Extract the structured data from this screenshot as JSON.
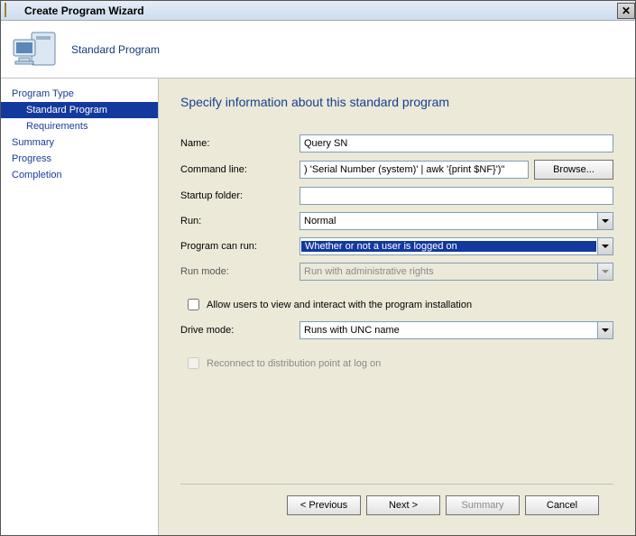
{
  "titlebar": {
    "title": "Create Program Wizard"
  },
  "banner": {
    "subtitle": "Standard Program"
  },
  "sidebar": {
    "items": [
      {
        "label": "Program Type",
        "indent": false,
        "active": false
      },
      {
        "label": "Standard Program",
        "indent": true,
        "active": true
      },
      {
        "label": "Requirements",
        "indent": true,
        "active": false
      },
      {
        "label": "Summary",
        "indent": false,
        "active": false
      },
      {
        "label": "Progress",
        "indent": false,
        "active": false
      },
      {
        "label": "Completion",
        "indent": false,
        "active": false
      }
    ]
  },
  "content": {
    "heading": "Specify information about this standard program",
    "rows": {
      "name": {
        "label": "Name:",
        "value": "Query SN"
      },
      "commandline": {
        "label": "Command line:",
        "value": ") 'Serial Number (system)' | awk '{print $NF}')\""
      },
      "browse": {
        "label": "Browse..."
      },
      "startupfolder": {
        "label": "Startup folder:",
        "value": ""
      },
      "run": {
        "label": "Run:",
        "value": "Normal"
      },
      "programcanrun": {
        "label": "Program can run:",
        "value": "Whether or not a user is logged on"
      },
      "runmode": {
        "label": "Run mode:",
        "value": "Run with administrative rights"
      },
      "drivemode": {
        "label": "Drive mode:",
        "value": "Runs with UNC name"
      }
    },
    "checks": {
      "allowInteract": {
        "label": "Allow users to view and interact with the program installation",
        "checked": false,
        "enabled": true
      },
      "reconnect": {
        "label": "Reconnect to distribution point at log on",
        "checked": false,
        "enabled": false
      }
    }
  },
  "footer": {
    "previous": "< Previous",
    "next": "Next >",
    "summary": "Summary",
    "cancel": "Cancel"
  }
}
